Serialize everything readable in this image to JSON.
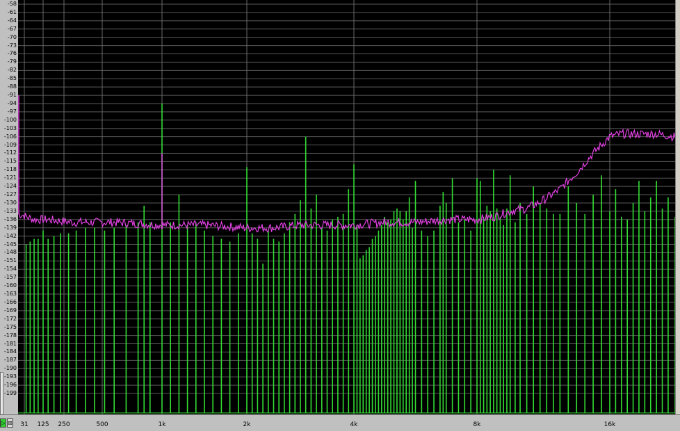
{
  "chart_data": {
    "type": "line",
    "x_scale": "log-like",
    "x_ticks": [
      "31",
      "125",
      "250",
      "500",
      "1k",
      "2k",
      "4k",
      "8k",
      "16k"
    ],
    "x_tick_hz": [
      31,
      125,
      250,
      500,
      1000,
      2000,
      4000,
      8000,
      16000
    ],
    "y_ticks": [
      "-58",
      "-61",
      "-64",
      "-67",
      "-70",
      "-73",
      "-76",
      "-79",
      "-82",
      "-85",
      "-88",
      "-91",
      "-94",
      "-97",
      "-100",
      "-103",
      "-106",
      "-109",
      "-112",
      "-115",
      "-118",
      "-121",
      "-124",
      "-127",
      "-130",
      "-133",
      "-136",
      "-139",
      "-142",
      "-145",
      "-148",
      "-151",
      "-154",
      "-157",
      "-160",
      "-163",
      "-166",
      "-169",
      "-172",
      "-175",
      "-178",
      "-181",
      "-184",
      "-187",
      "-190",
      "-193",
      "-196",
      "-199"
    ],
    "ylim": [
      -199,
      -58
    ],
    "grid": true,
    "series": [
      {
        "color": "#33dd33",
        "style": "spectral-peaks",
        "points": [
          [
            40,
            -145
          ],
          [
            60,
            -144
          ],
          [
            80,
            -143
          ],
          [
            100,
            -143
          ],
          [
            125,
            -140
          ],
          [
            155,
            -143
          ],
          [
            190,
            -142
          ],
          [
            230,
            -141
          ],
          [
            280,
            -141
          ],
          [
            330,
            -140
          ],
          [
            390,
            -139
          ],
          [
            450,
            -139
          ],
          [
            520,
            -140
          ],
          [
            600,
            -139
          ],
          [
            700,
            -138
          ],
          [
            800,
            -137
          ],
          [
            850,
            -131
          ],
          [
            900,
            -137
          ],
          [
            1000,
            -94
          ],
          [
            1100,
            -137
          ],
          [
            1200,
            -127
          ],
          [
            1300,
            -138
          ],
          [
            1400,
            -137
          ],
          [
            1500,
            -140
          ],
          [
            1600,
            -142
          ],
          [
            1700,
            -143
          ],
          [
            1800,
            -144
          ],
          [
            1900,
            -141
          ],
          [
            2000,
            -117
          ],
          [
            2100,
            -141
          ],
          [
            2200,
            -143
          ],
          [
            2300,
            -152
          ],
          [
            2400,
            -140
          ],
          [
            2500,
            -143
          ],
          [
            2600,
            -144
          ],
          [
            2700,
            -141
          ],
          [
            2800,
            -137
          ],
          [
            2900,
            -134
          ],
          [
            3000,
            -129
          ],
          [
            3100,
            -106
          ],
          [
            3200,
            -132
          ],
          [
            3300,
            -127
          ],
          [
            3400,
            -139
          ],
          [
            3500,
            -140
          ],
          [
            3600,
            -136
          ],
          [
            3700,
            -135
          ],
          [
            3800,
            -134
          ],
          [
            3900,
            -125
          ],
          [
            4000,
            -116
          ],
          [
            4100,
            -138
          ],
          [
            4200,
            -150
          ],
          [
            4300,
            -149
          ],
          [
            4400,
            -147
          ],
          [
            4500,
            -146
          ],
          [
            4600,
            -143
          ],
          [
            4700,
            -142
          ],
          [
            4800,
            -140
          ],
          [
            4900,
            -138
          ],
          [
            5000,
            -135
          ],
          [
            5100,
            -137
          ],
          [
            5200,
            -136
          ],
          [
            5300,
            -133
          ],
          [
            5400,
            -132
          ],
          [
            5500,
            -133
          ],
          [
            5600,
            -136
          ],
          [
            5700,
            -133
          ],
          [
            5800,
            -128
          ],
          [
            5900,
            -139
          ],
          [
            6000,
            -122
          ],
          [
            6200,
            -140
          ],
          [
            6400,
            -142
          ],
          [
            6600,
            -140
          ],
          [
            6800,
            -131
          ],
          [
            6900,
            -126
          ],
          [
            7000,
            -130
          ],
          [
            7200,
            -121
          ],
          [
            7400,
            -137
          ],
          [
            7600,
            -136
          ],
          [
            7800,
            -140
          ],
          [
            8000,
            -121
          ],
          [
            8200,
            -122
          ],
          [
            8400,
            -135
          ],
          [
            8600,
            -131
          ],
          [
            8800,
            -133
          ],
          [
            9000,
            -118
          ],
          [
            9200,
            -132
          ],
          [
            9400,
            -135
          ],
          [
            9600,
            -138
          ],
          [
            9800,
            -132
          ],
          [
            10000,
            -120
          ],
          [
            10300,
            -137
          ],
          [
            10600,
            -130
          ],
          [
            11000,
            -134
          ],
          [
            11400,
            -124
          ],
          [
            11800,
            -130
          ],
          [
            12200,
            -132
          ],
          [
            12600,
            -134
          ],
          [
            13000,
            -134
          ],
          [
            13500,
            -124
          ],
          [
            14000,
            -130
          ],
          [
            14500,
            -134
          ],
          [
            15000,
            -127
          ],
          [
            15500,
            -120
          ],
          [
            16000,
            -133
          ],
          [
            16500,
            -125
          ],
          [
            17000,
            -135
          ],
          [
            17500,
            -136
          ],
          [
            18000,
            -130
          ],
          [
            18500,
            -122
          ],
          [
            19000,
            -133
          ],
          [
            19500,
            -128
          ],
          [
            20000,
            -122
          ],
          [
            20500,
            -132
          ],
          [
            21000,
            -128
          ],
          [
            21600,
            -135
          ]
        ]
      },
      {
        "color": "#e040e0",
        "style": "noise-floor",
        "points": [
          [
            20,
            -134
          ],
          [
            40,
            -135
          ],
          [
            80,
            -136
          ],
          [
            150,
            -136
          ],
          [
            300,
            -137
          ],
          [
            600,
            -137
          ],
          [
            1000,
            -138
          ],
          [
            1500,
            -138
          ],
          [
            2000,
            -139
          ],
          [
            2500,
            -139
          ],
          [
            3000,
            -138
          ],
          [
            3500,
            -138
          ],
          [
            4000,
            -138
          ],
          [
            5000,
            -137
          ],
          [
            6000,
            -137
          ],
          [
            7000,
            -136
          ],
          [
            8000,
            -136
          ],
          [
            9000,
            -135
          ],
          [
            10000,
            -133
          ],
          [
            11000,
            -132
          ],
          [
            12000,
            -129
          ],
          [
            13000,
            -125
          ],
          [
            14000,
            -119
          ],
          [
            15000,
            -112
          ],
          [
            16000,
            -106
          ],
          [
            17000,
            -105
          ],
          [
            18000,
            -105
          ],
          [
            19000,
            -105
          ],
          [
            20000,
            -105
          ],
          [
            21600,
            -106
          ]
        ],
        "spike": [
          1000,
          -112
        ]
      }
    ]
  }
}
